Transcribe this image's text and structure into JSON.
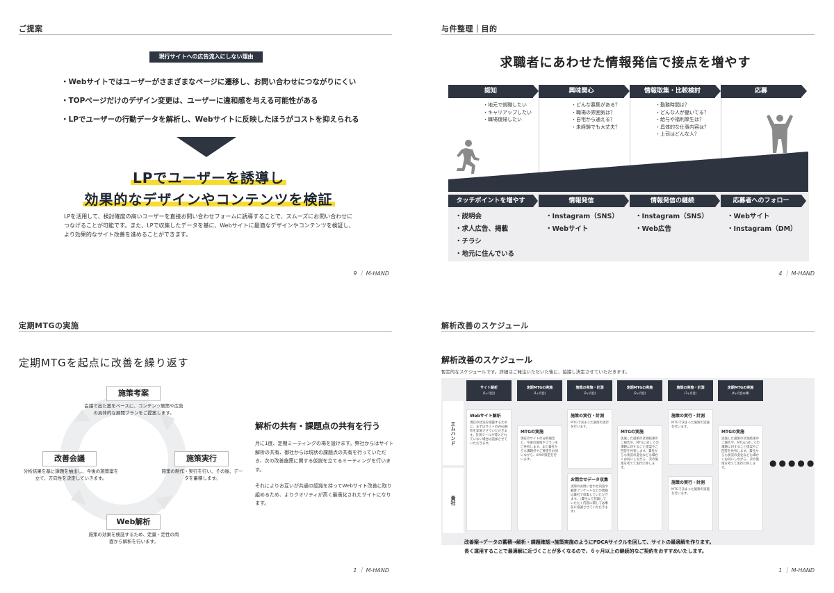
{
  "slide1": {
    "section_title": "ご提案",
    "reason_tag": "現行サイトへの広告流入にしない理由",
    "bullets": [
      "・Webサイトではユーザーがさまざまなページに遷移し、お問い合わせにつながりにくい",
      "・TOPページだけのデザイン変更は、ユーザーに違和感を与える可能性がある",
      "・LPでユーザーの行動データを解析し、Webサイトに反映したほうがコストを抑えられる"
    ],
    "headline_line1": "LPでユーザーを誘導し",
    "headline_line2": "効果的なデザインやコンテンツを検証",
    "paragraph": "LPを活用して、検討確度の高いユーザーを直接お問い合わせフォームに誘導することで、スムーズにお問い合わせにつなげることが可能です。また、LPで収集したデータを基に、Webサイトに最適なデザインやコンテンツを検証し、より効果的なサイト改善を進めることができます。",
    "footer": "9 ｜ M-HAND"
  },
  "slide2": {
    "section_title": "与件整理｜目的",
    "title": "求職者にあわせた情報発信で接点を増やす",
    "stages": [
      "認知",
      "興味関心",
      "情報取集・比較検討",
      "応募"
    ],
    "questions": [
      [
        "・地元で就職したい",
        "・キャリアップしたい",
        "・職場復帰したい"
      ],
      [
        "・どんな募集がある？",
        "・職場の雰囲気は？",
        "・自宅から通える？",
        "・未経験でも大丈夫？"
      ],
      [
        "・勤務時間は？",
        "・どんな人が働いてる？",
        "・給与や福利厚生は？",
        "・具体的な仕事内容は？",
        "・上司はどんな人？"
      ]
    ],
    "touchpoints": [
      "タッチポイントを増やす",
      "情報発信",
      "情報発信の継続",
      "応募者へのフォロー"
    ],
    "touch_items": [
      [
        "・説明会",
        "・求人広告、掲載",
        "・チラシ",
        "・地元に住んでいる"
      ],
      [
        "・Instagram（SNS）",
        "・Webサイト"
      ],
      [
        "・Instagram（SNS）",
        "・Web広告"
      ],
      [
        "・Webサイト",
        "・Instagram（DM）"
      ]
    ],
    "footer": "4 ｜ M-HAND",
    "colors": {
      "dark": "#2e3540"
    }
  },
  "slide3": {
    "section_title": "定期MTGの実施",
    "title": "定期MTGを起点に改善を繰り返す",
    "cycle": {
      "top": {
        "label": "施策考案",
        "desc": "会議で出た案をベースに、コンテンツ施策や広告の具体的な展開プランをご提案します。"
      },
      "right": {
        "label": "施策実行",
        "desc": "施策の制作・実行を行い、その後、データを蓄積します。"
      },
      "bottom": {
        "label": "Web解析",
        "desc": "施策の効果を検証するため、定量・定性の両面から解析を行います。"
      },
      "left": {
        "label": "改善会議",
        "desc": "分析結果を基に課題を抽出し、今後の施策案を立て、方向性を決定していきます。"
      }
    },
    "subtitle": "解析の共有・課題点の共有を行う",
    "paragraph1": "月に1度、定期ミーティングの場を設けます。弊社からはサイト解析の共有、御社からは現状の課題点の共有を行っていただき、次の改善施策に関する仮説を立てるミーティングを行います。",
    "paragraph2": "それによりお互いが共通の認識を持ってWebサイト改善に取り組めるため、よりクオリティが高く最適化されたサイトになります。",
    "footer": "1 ｜ M-HAND"
  },
  "slide4": {
    "section_title": "解析改善のスケジュール",
    "title": "解析改善のスケジュール",
    "note": "暫定的なスケジュールです。詳細はご発注いただいた後に、協議し決定させていただきます。",
    "row_labels": [
      "エムハンド",
      "貴社"
    ],
    "headers": [
      {
        "title": "サイト解析",
        "sub": "(1ヶ月目)"
      },
      {
        "title": "定期MTGの実施",
        "sub": "(1ヶ月目)"
      },
      {
        "title": "施策の実施・計測",
        "sub": "(2ヶ月目)"
      },
      {
        "title": "定期MTGの実施",
        "sub": "(2ヶ月目)"
      },
      {
        "title": "施策の実施・計測",
        "sub": "(3ヶ月目)"
      },
      {
        "title": "定期MTGの実施",
        "sub": "(4ヶ月目以降)"
      }
    ],
    "cells": {
      "c1": {
        "title": "Webサイト解析",
        "text": "現在の状況を把握するために、まずはサイトのWeb解析を実施させていただきます。計測ツールが導入されていない場合は追加させていただきます。"
      },
      "c2": {
        "title": "MTGの実施",
        "text": "現在のサイトの分析報告と、今後の施策やプランをご共有します。また貴社からも課題点やご要望をお伺いながら、KPIの策定を行います。"
      },
      "c3": {
        "title": "施策の実行・計測",
        "text": "MTGで決まった施策の実行を行います。"
      },
      "c4": {
        "title": "MTGの実施",
        "text": "実施した施策の計測結果のご報告や、MTGに対しての課題に対すること提案やご回答を共有します。貴社からも状況の変化なども細かくお伺いしながら、次の施策を考えて実行に移します。"
      },
      "c5": {
        "title": "施策の実行・計測",
        "text": "MTGで決まった施策の実施を行います。"
      },
      "c6": {
        "title": "MTGの実施",
        "text": "実施した施策の計測結果のご報告や、MTGに対しての課題に対すること提案やご回答を共有します。貴社からも状況の変化なども細かくお伺いしながら、次の施策を考えて実行に移します。"
      },
      "c7": {
        "title": "お問合せデータ収集",
        "text": "実際のお問い合わせ内容や顧客アンケートなどの情報は貴社で収集していただきます。（貴社にて記録していただく内容に関しては事前に協議させていただきます）"
      },
      "c8": {
        "title": "施策の実行・計測",
        "text": "MTGで決まった施策の実施を行います。"
      }
    },
    "dots": "●●●●●",
    "footer_line1": "改善案→データの蓄積→解析・課題確認→施策実施のようにPDCAサイクルを回して、サイトの最適解を作ります。",
    "footer_line2": "長く運用することで最適解に近づくことが多くなるので、６ヶ月以上の継続的なご契約をおすすめいたします。",
    "footer": "1 ｜ M-HAND"
  }
}
